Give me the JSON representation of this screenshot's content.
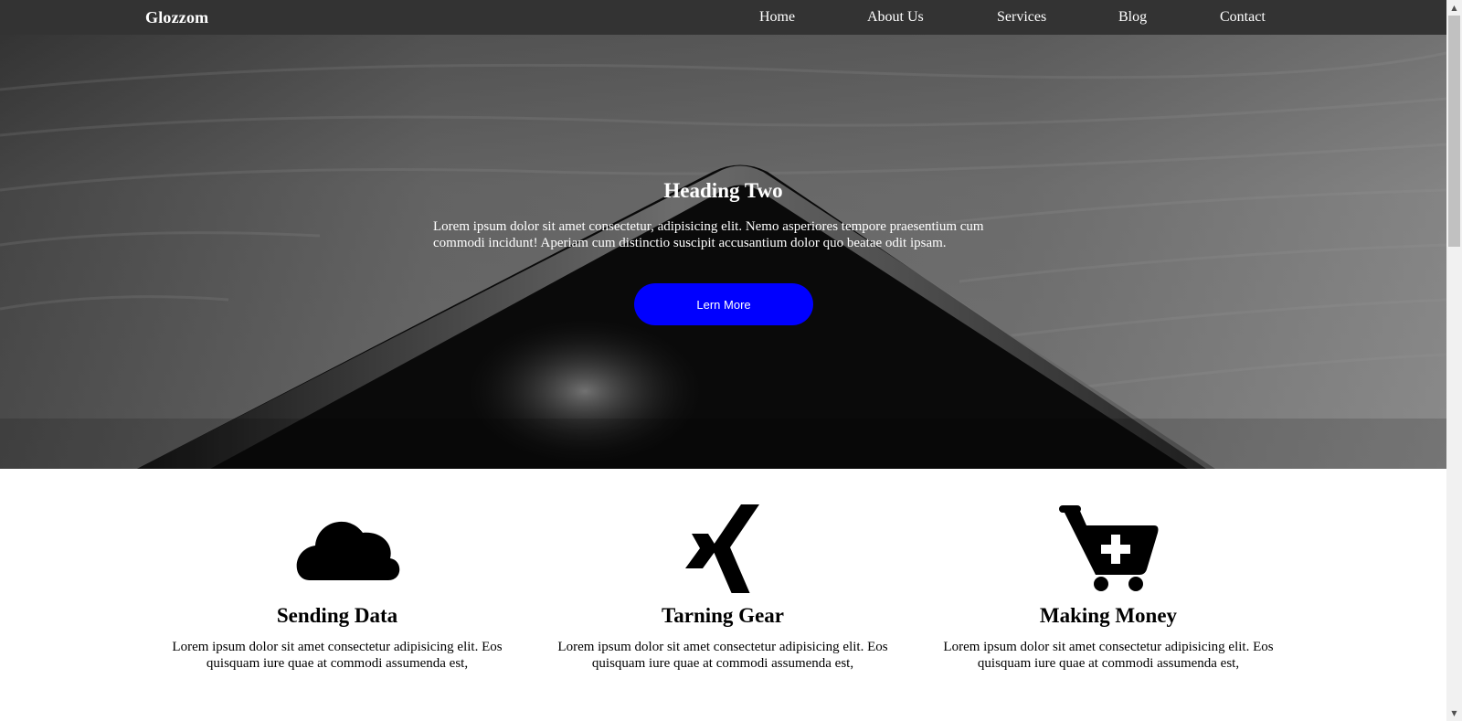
{
  "navbar": {
    "brand": "Glozzom",
    "links": [
      "Home",
      "About Us",
      "Services",
      "Blog",
      "Contact"
    ]
  },
  "hero": {
    "title": "Heading Two",
    "text": "Lorem ipsum dolor sit amet consectetur, adipisicing elit. Nemo asperiores tempore praesentium cum commodi incidunt! Aperiam cum distinctio suscipit accusantium dolor quo beatae odit ipsam.",
    "button_label": "Lern More"
  },
  "features": [
    {
      "icon": "cloud-icon",
      "title": "Sending Data",
      "text": "Lorem ipsum dolor sit amet consectetur adipisicing elit. Eos quisquam iure quae at commodi assumenda est,"
    },
    {
      "icon": "xing-icon",
      "title": "Tarning Gear",
      "text": "Lorem ipsum dolor sit amet consectetur adipisicing elit. Eos quisquam iure quae at commodi assumenda est,"
    },
    {
      "icon": "cart-plus-icon",
      "title": "Making Money",
      "text": "Lorem ipsum dolor sit amet consectetur adipisicing elit. Eos quisquam iure quae at commodi assumenda est,"
    }
  ],
  "colors": {
    "navbar_bg": "#333333",
    "button_bg": "#0000ff",
    "text_light": "#ffffff",
    "text_dark": "#000000"
  },
  "scrollbar": {
    "up_icon": "arrow-up-icon",
    "down_icon": "arrow-down-icon"
  }
}
